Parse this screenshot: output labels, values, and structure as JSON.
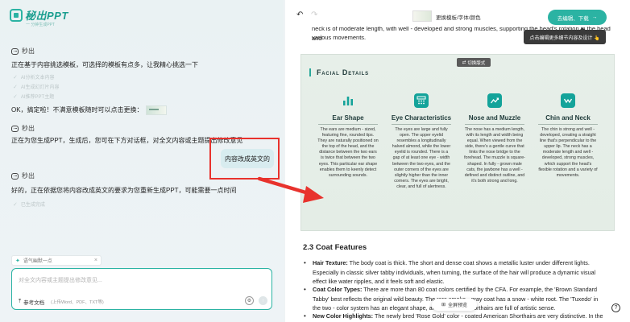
{
  "brand": {
    "name": "秘出PPT",
    "tagline": "一 分钟生成PPT"
  },
  "chat": {
    "bot_name": "秒出",
    "msg1": "正在基于内容挑选模板，可选择的模板有点多，让我精心挑选一下",
    "steps": [
      "AI分析文本内容",
      "AI生成幻灯片内容",
      "AI推荐PPT主题"
    ],
    "msg2": "OK，搞定啦！不满意模板随时可以点击更换：",
    "msg3": "正在为您生成PPT，生成后，您可在下方对话框，对全文内容或主题提出修改意见",
    "user_msg": "内容改成英文的",
    "msg4": "好的，正在依据您将内容改成英文的要求为您重新生成PPT，可能需要一点时间",
    "step_done": "已生成完成"
  },
  "composer": {
    "chip_label": "语气幽默一点",
    "placeholder": "对全文内容或主题提出修改意见...",
    "upload_label": "参考文档",
    "upload_hint": "(上传Word、PDF、TXT等)"
  },
  "toolbar": {
    "template_label": "更换模板/字体/颜色",
    "download_label": "去编辑、下载",
    "download_arrow": "→",
    "tooltip": "点击编辑更多细节内容及设计 👆"
  },
  "doc": {
    "intro_line1": "neck is of moderate length, with well - developed and strong muscles, supporting the head's rotation in the head and",
    "intro_line2": "various movements.",
    "slide": {
      "switch_label": "切换版式",
      "title": "Facial Details",
      "columns": [
        {
          "title": "Ear Shape",
          "icon": "bar-chart-icon",
          "text": "The ears are medium - sized, featuring fine, rounded tips. They are naturally positioned on the top of the head, and the distance between the two ears is twice that between the two eyes. This particular ear shape enables them to keenly detect surrounding sounds."
        },
        {
          "title": "Eye Characteristics",
          "icon": "calculator-icon",
          "text": "The eyes are large and fully open. The upper eyelid resembles a longitudinally halved almond, while the lower eyelid is rounded. There is a gap of at least one eye - width between the two eyes, and the outer corners of the eyes are slightly higher than the inner corners. The eyes are bright, clear, and full of alertness."
        },
        {
          "title": "Nose and Muzzle",
          "icon": "trend-chart-icon",
          "text": "The nose has a medium length, with its length and width being equal. When viewed from the side, there's a gentle curve that links the nose bridge to the forehead. The muzzle is square-shaped. In fully - grown male cats, the jawbone has a well - defined and distinct outline, and it's both strong and long."
        },
        {
          "title": "Chin and Neck",
          "icon": "activity-icon",
          "text": "The chin is strong and well - developed, creating a straight line that's perpendicular to the upper lip. The neck has a moderate length and well - developed, strong muscles, which support the head's flexible rotation and a variety of movements."
        }
      ]
    },
    "section_title": "2.3 Coat Features",
    "bullets": [
      {
        "label": "Hair Texture:",
        "text": " The body coat is thick. The short and dense coat shows a metallic luster under different lights. Especially in classic silver tabby individuals, when turning, the surface of the hair will produce a dynamic visual effect like water ripples, and it feels soft and elastic."
      },
      {
        "label": "Coat Color Types:",
        "text": " There are more than 80 coat colors certified by the CFA. For example, the 'Brown Standard Tabby' best reflects the original wild beauty. The rare smoke - gray coat has a snow - white root. The 'Tuxedo' in the two - color system has an elegant shape, and the milk... Shorthairs are full of artistic sense."
      },
      {
        "label": "New Color Highlights:",
        "text": " The newly bred 'Rose Gold' color - coated American Shorthairs are very distinctive. In the sun,"
      }
    ],
    "full_preview": "全屏预览",
    "help": "?"
  }
}
